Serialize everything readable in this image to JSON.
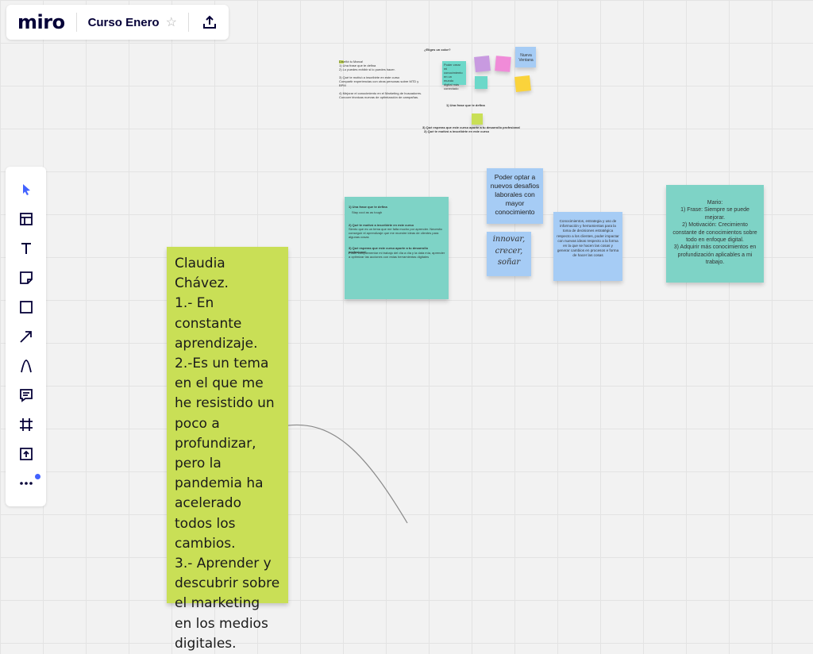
{
  "app": {
    "logo": "miro",
    "board_title": "Curso Enero",
    "icons": {
      "favorite": "star-icon",
      "share": "upload-icon"
    }
  },
  "toolbar": {
    "tools": [
      {
        "name": "select",
        "icon": "cursor-icon",
        "active": true
      },
      {
        "name": "templates",
        "icon": "template-icon"
      },
      {
        "name": "text",
        "icon": "text-icon"
      },
      {
        "name": "sticky-note",
        "icon": "sticky-note-icon"
      },
      {
        "name": "shape",
        "icon": "square-icon"
      },
      {
        "name": "connection-line",
        "icon": "arrow-icon"
      },
      {
        "name": "pen",
        "icon": "pen-icon"
      },
      {
        "name": "comment",
        "icon": "comment-icon"
      },
      {
        "name": "frame",
        "icon": "frame-icon"
      },
      {
        "name": "upload",
        "icon": "upload-icon"
      },
      {
        "name": "more",
        "icon": "ellipsis-icon",
        "badge": true
      }
    ]
  },
  "colors": {
    "accent": "#4262ff",
    "lime": "#c9df56",
    "teal": "#6cd8c9",
    "teal_dark": "#7ed3c6",
    "light_blue": "#a6ccf5",
    "pink": "#f08bd8",
    "purple": "#c89ae0",
    "yellow": "#fad33b",
    "canvas": "#f2f2f2"
  },
  "notes": {
    "claudia": "Claudia Chávez.\n1.- En constante aprendizaje.\n2.-Es un tema en el que me he resistido un poco a profundizar, pero la pandemia ha acelerado todos los cambios.\n3.- Aprender y descubrir sobre el marketing en los medios digitales.",
    "mario": "Mario:\n1) Frase:  Siempre se puede mejorar.\n2) Motivación: Crecimiento constante de conocimientos sobre todo en enfoque digital.\n3) Adquirir más conocimientos en profundización aplicables a mi trabajo.",
    "desafios": "Poder optar a nuevos desafios laborales con mayor conocimiento",
    "innovar": "innovar,\ncrecer,\nsoñar",
    "conocimientos": "Conocimientos, estrategia y uso de información y herramientas para la toma de decisiones estratégica respecto a los clientes, poder impactar con nuevas ideas  respecto a la forma en la que se hacen las cosas y generar cambios en procesos  e forma de hacer las cosas",
    "teal_q1": "1) Una frase que te defina",
    "teal_a1": "Stay cool as as tough",
    "teal_q2": "2) Qué te motivó a inscribirte en este curso",
    "teal_a2": "Siento que es un tema que me falta mucho por aprender. Necesito conseguir el aprendizaje que me muestre ideas de clientes para algunas cosas",
    "teal_q3": "3) Qué esperas que este curso aporte a tu desarrollo profesional",
    "teal_a3": "Poder complementar mi trabajo del día a día y la data mía, aprender a optimizar las acciones con estas herramientas digitales"
  },
  "top_cluster": {
    "heading": "¿Eliges un color?",
    "instructions": "Diseñá tu Marca!\n1) Una frase que te defina\n2) Lo puedes exhibir si lo puedes hacer.\n\n3) Qué te motivó a inscribirte en este curso\nCompartir experiencias con otras personas sobre MTD y BPM\n\n4) Mejorar el conocimiento en el Marketing de buscadores.\nConocer técnicas nuevas de optimización de campañas.",
    "teal_small": "Poder crear\nmi\nconocimiento\nen un\nmundo\ndigital más\nconectado",
    "blue_small": "Nueva\nVentana",
    "q1": "1) Una frase que te defina",
    "q3": "3) Qué esperas que este curso aporte a tu desarrollo profesional",
    "q2": "2) Qué te motivó a inscribirte en este curso"
  }
}
